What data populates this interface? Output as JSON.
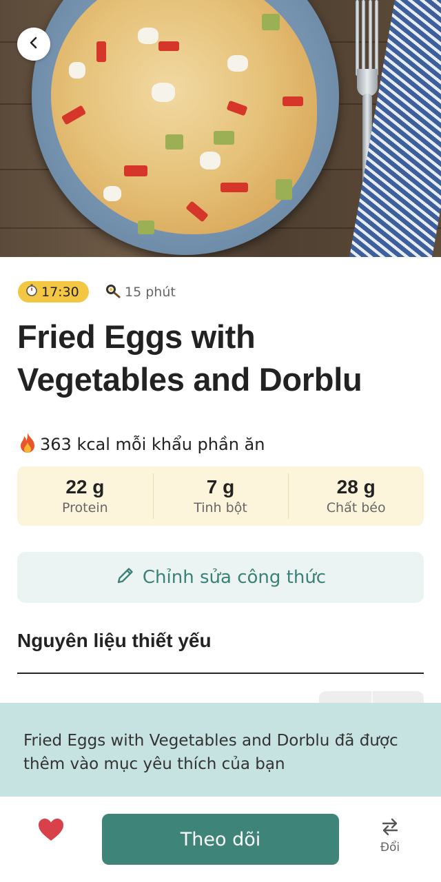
{
  "recipe": {
    "time_badge": "17:30",
    "duration": "15 phút",
    "title": "Fried Eggs with Vegetables and Dorblu",
    "kcal_text": "363 kcal mỗi khẩu phần ăn",
    "macros": [
      {
        "value": "22 g",
        "label": "Protein"
      },
      {
        "value": "7 g",
        "label": "Tinh bột"
      },
      {
        "value": "28 g",
        "label": "Chất béo"
      }
    ]
  },
  "actions": {
    "edit_label": "Chỉnh sửa công thức",
    "follow_label": "Theo dõi",
    "swap_label": "Đổi"
  },
  "ingredients": {
    "section_title": "Nguyên liệu thiết yếu"
  },
  "toast": {
    "message": "Fried Eggs with Vegetables and Dorblu đã được thêm vào mục yêu thích của bạn"
  },
  "icons": {
    "back": "chevron-left-icon",
    "timer": "stopwatch-icon",
    "duration": "frying-pan-icon",
    "kcal": "fire-icon",
    "edit": "pencil-icon",
    "favorite": "heart-icon",
    "swap": "swap-arrows-icon"
  },
  "colors": {
    "accent": "#3e8478",
    "time_badge": "#f3c744",
    "macro_bg": "#fdf4dc",
    "toast_bg": "#c6e3e2",
    "heart": "#d9414a"
  }
}
